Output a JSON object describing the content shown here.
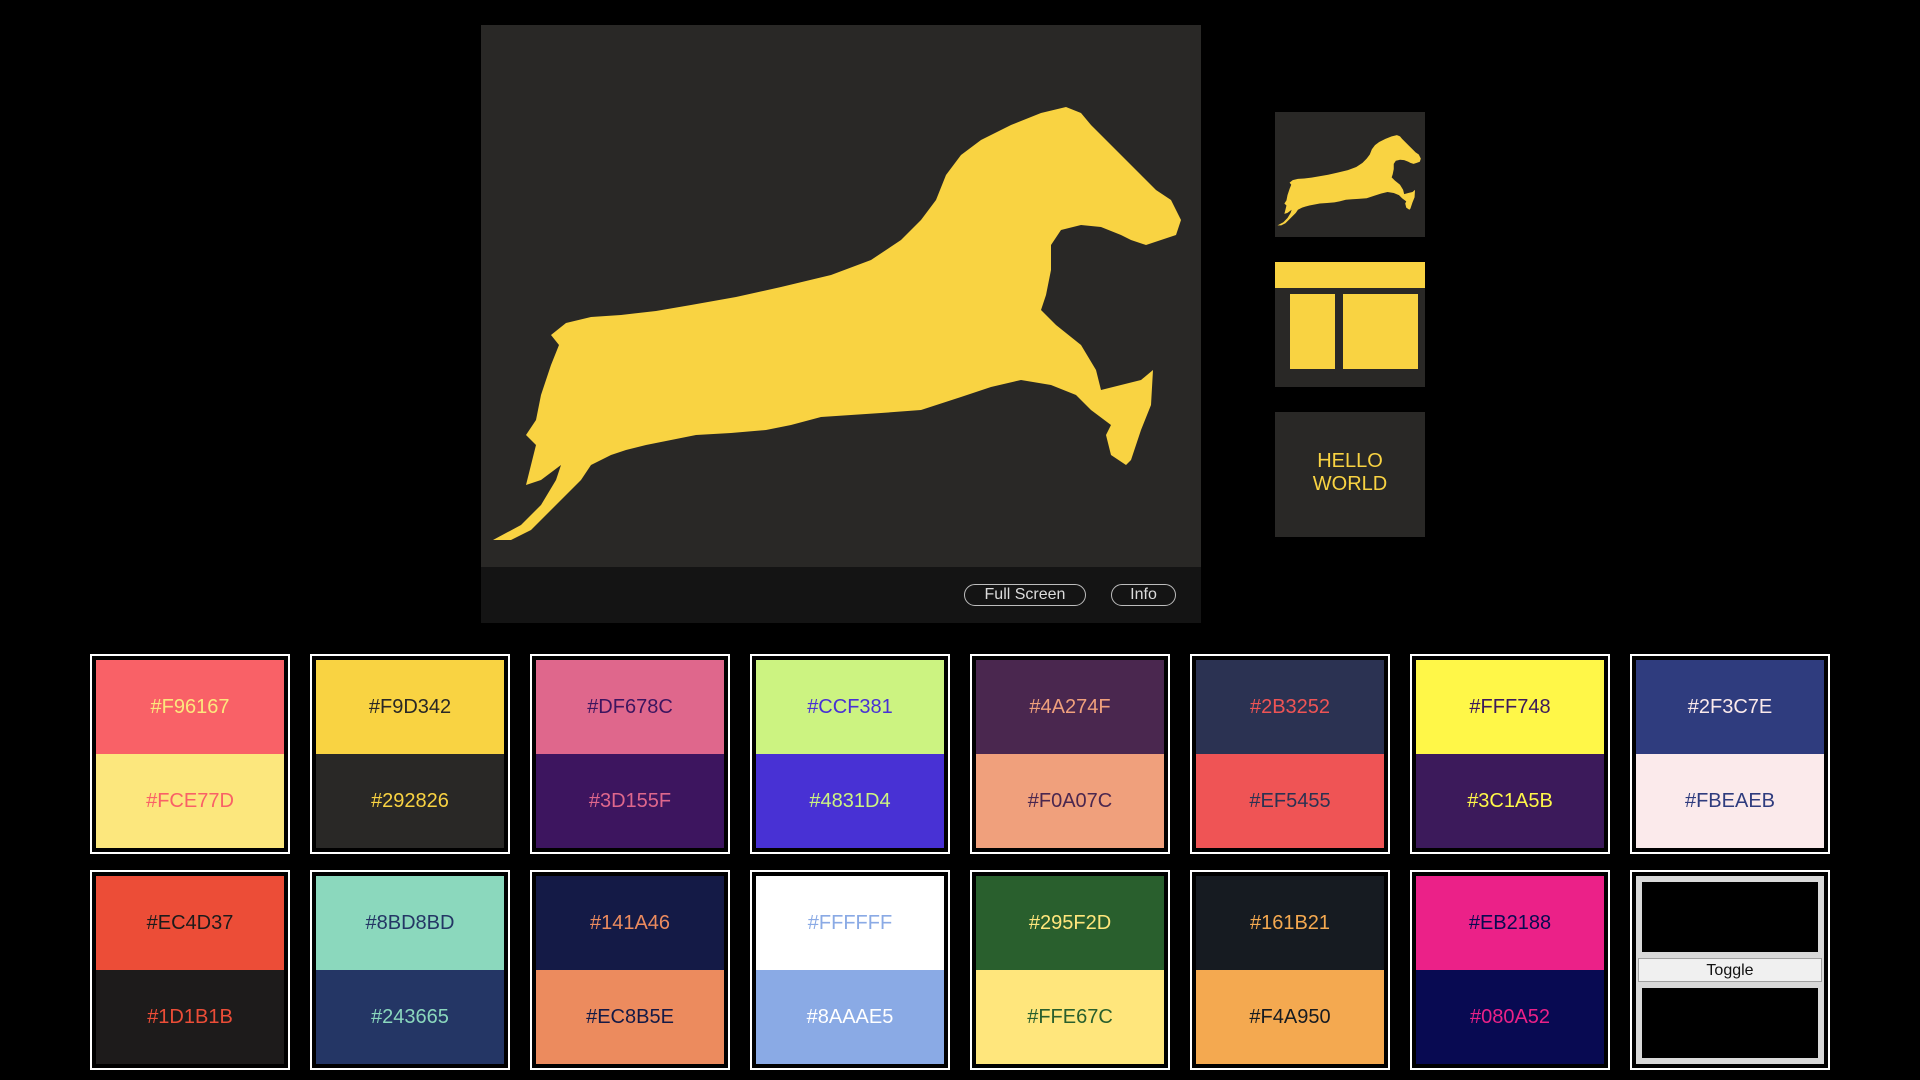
{
  "preview": {
    "fullscreen_label": "Full Screen",
    "info_label": "Info"
  },
  "thumbnails": {
    "text_thumb": "HELLO\nWORLD"
  },
  "colors": {
    "accent": "#F9D342",
    "panel": "#292826"
  },
  "swatches": [
    {
      "top_color": "#F96167",
      "top_label": "#F96167",
      "top_text": "#FCE77D",
      "bottom_color": "#FCE77D",
      "bottom_label": "#FCE77D",
      "bottom_text": "#F96167"
    },
    {
      "top_color": "#F9D342",
      "top_label": "#F9D342",
      "top_text": "#292826",
      "bottom_color": "#292826",
      "bottom_label": "#292826",
      "bottom_text": "#F9D342"
    },
    {
      "top_color": "#DF678C",
      "top_label": "#DF678C",
      "top_text": "#3D155F",
      "bottom_color": "#3D155F",
      "bottom_label": "#3D155F",
      "bottom_text": "#DF678C"
    },
    {
      "top_color": "#CCF381",
      "top_label": "#CCF381",
      "top_text": "#4831D4",
      "bottom_color": "#4831D4",
      "bottom_label": "#4831D4",
      "bottom_text": "#CCF381"
    },
    {
      "top_color": "#4A274F",
      "top_label": "#4A274F",
      "top_text": "#F0A07C",
      "bottom_color": "#F0A07C",
      "bottom_label": "#F0A07C",
      "bottom_text": "#4A274F"
    },
    {
      "top_color": "#2B3252",
      "top_label": "#2B3252",
      "top_text": "#EF5455",
      "bottom_color": "#EF5455",
      "bottom_label": "#EF5455",
      "bottom_text": "#2B3252"
    },
    {
      "top_color": "#FFF748",
      "top_label": "#FFF748",
      "top_text": "#3C1A5B",
      "bottom_color": "#3C1A5B",
      "bottom_label": "#3C1A5B",
      "bottom_text": "#FFF748"
    },
    {
      "top_color": "#2F3C7E",
      "top_label": "#2F3C7E",
      "top_text": "#FBEAEB",
      "bottom_color": "#FBEAEB",
      "bottom_label": "#FBEAEB",
      "bottom_text": "#2F3C7E"
    },
    {
      "top_color": "#EC4D37",
      "top_label": "#EC4D37",
      "top_text": "#1D1B1B",
      "bottom_color": "#1D1B1B",
      "bottom_label": "#1D1B1B",
      "bottom_text": "#EC4D37"
    },
    {
      "top_color": "#8BD8BD",
      "top_label": "#8BD8BD",
      "top_text": "#243665",
      "bottom_color": "#243665",
      "bottom_label": "#243665",
      "bottom_text": "#8BD8BD"
    },
    {
      "top_color": "#141A46",
      "top_label": "#141A46",
      "top_text": "#EC8B5E",
      "bottom_color": "#EC8B5E",
      "bottom_label": "#EC8B5E",
      "bottom_text": "#141A46"
    },
    {
      "top_color": "#FFFFFF",
      "top_label": "#FFFFFF",
      "top_text": "#8AAAE5",
      "bottom_color": "#8AAAE5",
      "bottom_label": "#8AAAE5",
      "bottom_text": "#FFFFFF"
    },
    {
      "top_color": "#295F2D",
      "top_label": "#295F2D",
      "top_text": "#FFE67C",
      "bottom_color": "#FFE67C",
      "bottom_label": "#FFE67C",
      "bottom_text": "#295F2D"
    },
    {
      "top_color": "#161B21",
      "top_label": "#161B21",
      "top_text": "#F4A950",
      "bottom_color": "#F4A950",
      "bottom_label": "#F4A950",
      "bottom_text": "#161B21"
    },
    {
      "top_color": "#EB2188",
      "top_label": "#EB2188",
      "top_text": "#080A52",
      "bottom_color": "#080A52",
      "bottom_label": "#080A52",
      "bottom_text": "#EB2188"
    }
  ],
  "toggle": {
    "label": "Toggle"
  }
}
